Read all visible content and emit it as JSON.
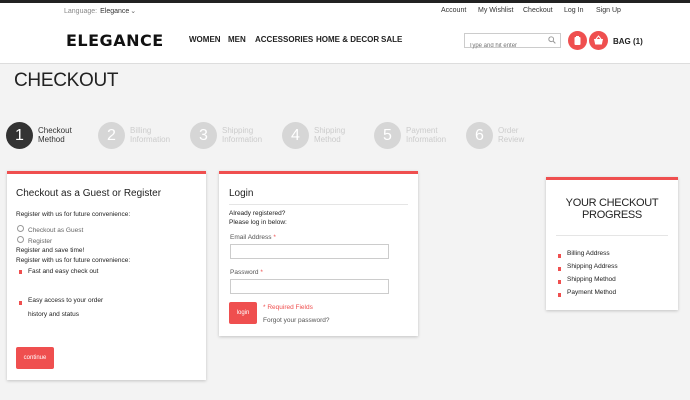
{
  "topbar": {
    "language_label": "Language:",
    "language_value": "Elegance",
    "links": [
      "Account",
      "My Wishlist",
      "Checkout",
      "Log In",
      "Sign Up"
    ]
  },
  "header": {
    "logo": "ELEGANCE",
    "nav": [
      "WOMEN",
      "MEN",
      "ACCESSORIES",
      "HOME & DECOR",
      "SALE"
    ],
    "search_placeholder": "Type and hit enter",
    "bag_label": "BAG (1)",
    "accent_color": "#ef4f4f"
  },
  "page_title": "CHECKOUT",
  "steps": [
    {
      "num": "1",
      "line1": "Checkout",
      "line2": "Method",
      "active": true
    },
    {
      "num": "2",
      "line1": "Billing",
      "line2": "Information",
      "active": false
    },
    {
      "num": "3",
      "line1": "Shipping",
      "line2": "Information",
      "active": false
    },
    {
      "num": "4",
      "line1": "Shipping",
      "line2": "Method",
      "active": false
    },
    {
      "num": "5",
      "line1": "Payment",
      "line2": "Information",
      "active": false
    },
    {
      "num": "6",
      "line1": "Order",
      "line2": "Review",
      "active": false
    }
  ],
  "guest": {
    "title": "Checkout as a Guest or Register",
    "intro": "Register with us for future convenience:",
    "option_guest": "Checkout as Guest",
    "option_register": "Register",
    "register_save": "Register and save time!",
    "register_convenience": "Register with us for future convenience:",
    "benefit_1": "Fast and easy check out",
    "benefit_2_line1": "Easy access to your order",
    "benefit_2_line2": "history and status",
    "continue_label": "continue"
  },
  "login": {
    "title": "Login",
    "already": "Already registered?",
    "please": "Please log in below:",
    "email_label": "Email Address",
    "password_label": "Password",
    "asterisk": "*",
    "login_button": "login",
    "required": "* Required Fields",
    "forgot": "Forgot your password?"
  },
  "progress": {
    "title_line1": "YOUR CHECKOUT",
    "title_line2": "PROGRESS",
    "items": [
      "Billing Address",
      "Shipping Address",
      "Shipping Method",
      "Payment Method"
    ]
  }
}
